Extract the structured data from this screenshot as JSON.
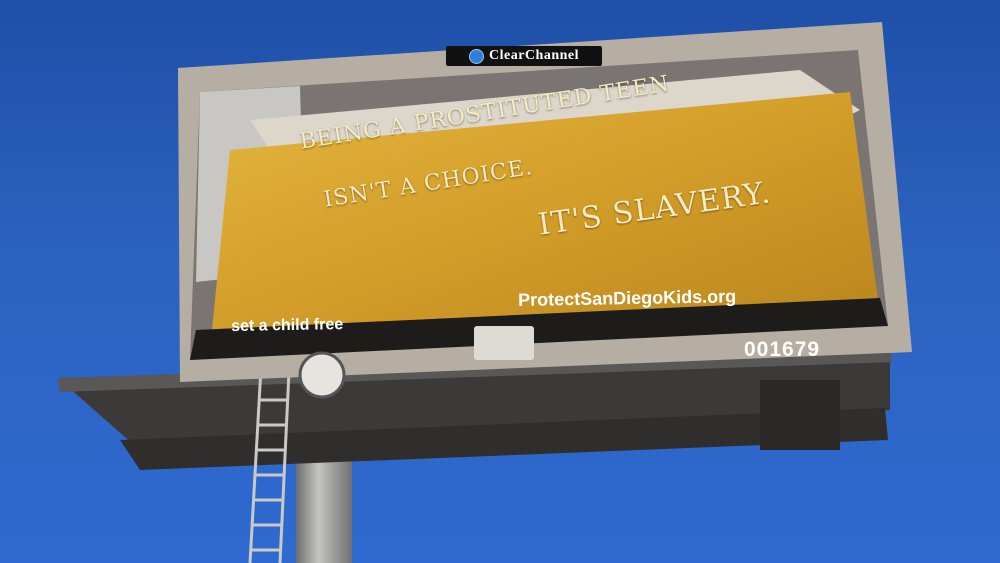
{
  "sky": {
    "color": "#2c62c0"
  },
  "billboard": {
    "operator_brand": "ClearChannel",
    "operator_brand_display": "ClearChannel",
    "headline": {
      "line1": "Being a prostituted teen",
      "line2": "isn't a choice.",
      "line3": "It's slavery."
    },
    "tagline": "set a child free",
    "website": "ProtectSanDiegoKids.org",
    "panel_number": "001679"
  },
  "colors": {
    "frame": "#b6aea2",
    "bedspread": "#d9a630",
    "headline_text": "#f6ecc0",
    "pole": "#9a9a98"
  },
  "icons": {
    "operator_logo": "clear-channel-logo-icon",
    "light": "floodlight-icon"
  }
}
